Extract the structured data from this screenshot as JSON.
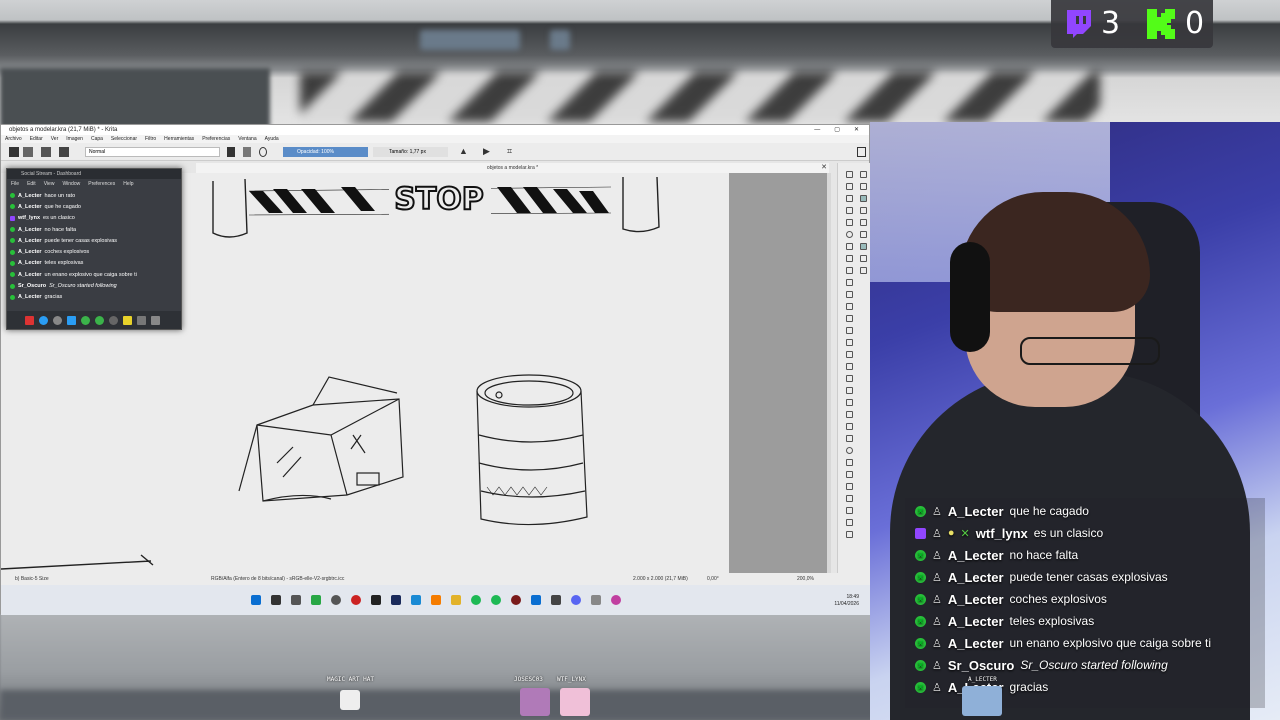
{
  "window": {
    "title": "objetos a modelar.kra (21,7 MiB) * - Krita"
  },
  "menu": [
    "Archivo",
    "Editar",
    "Ver",
    "Imagen",
    "Capa",
    "Seleccionar",
    "Filtro",
    "Herramientas",
    "Preferencias",
    "Ventana",
    "Ayuda"
  ],
  "toolbar": {
    "blend_mode": "Normal",
    "opacity": "Opacidad: 100%",
    "size": "Tamaño: 1,77 px"
  },
  "document_tab": {
    "title": "objetos a modelar.kra *"
  },
  "canvas": {
    "sign_text": "STOP"
  },
  "statusbar": {
    "brush": "b) Basic-5 Size",
    "color_info": "RGB/Alfa (Entero de 8 bits/canal) - sRGB-elle-V2-srgbtrc.icc",
    "dims": "2.000 x 2.000 (21,7 MiB)",
    "angle": "0,00°",
    "zoom": "200,0%"
  },
  "taskbar": {
    "time": "18:49",
    "date": "11/04/2026"
  },
  "social": {
    "title": "Social Stream - Dashboard",
    "menu": [
      "File",
      "Edit",
      "View",
      "Window",
      "Preferences",
      "Help"
    ],
    "messages": [
      {
        "name": "A_Lecter",
        "text": "hace un rato",
        "platform": "kick"
      },
      {
        "name": "A_Lecter",
        "text": "que he cagado",
        "platform": "kick"
      },
      {
        "name": "wtf_lynx",
        "text": "es un clasico",
        "platform": "twitch"
      },
      {
        "name": "A_Lecter",
        "text": "no hace falta",
        "platform": "kick"
      },
      {
        "name": "A_Lecter",
        "text": "puede tener casas explosivas",
        "platform": "kick"
      },
      {
        "name": "A_Lecter",
        "text": "coches explosivos",
        "platform": "kick"
      },
      {
        "name": "A_Lecter",
        "text": "teles explosivas",
        "platform": "kick"
      },
      {
        "name": "A_Lecter",
        "text": "un enano explosivo que caiga sobre ti",
        "platform": "kick"
      },
      {
        "name": "Sr_Oscuro",
        "text": "Sr_Oscuro started following",
        "platform": "kick"
      },
      {
        "name": "A_Lecter",
        "text": "gracias",
        "platform": "kick"
      }
    ]
  },
  "counters": {
    "twitch": "3",
    "kick": "0",
    "twitch_color": "#9146ff",
    "kick_color": "#53fc18"
  },
  "chat": [
    {
      "name": "A_Lecter",
      "text": "que he cagado",
      "platform": "kick"
    },
    {
      "name": "wtf_lynx",
      "text": "es un clasico",
      "platform": "twitch"
    },
    {
      "name": "A_Lecter",
      "text": "no hace falta",
      "platform": "kick"
    },
    {
      "name": "A_Lecter",
      "text": "puede tener casas explosivas",
      "platform": "kick"
    },
    {
      "name": "A_Lecter",
      "text": "coches explosivos",
      "platform": "kick"
    },
    {
      "name": "A_Lecter",
      "text": "teles explosivas",
      "platform": "kick"
    },
    {
      "name": "A_Lecter",
      "text": "un enano explosivo que caiga sobre ti",
      "platform": "kick"
    },
    {
      "name": "Sr_Oscuro",
      "text": "Sr_Oscuro started following",
      "platform": "kick"
    },
    {
      "name": "A_Lecter",
      "text": "gracias",
      "platform": "kick"
    }
  ],
  "characters": [
    "MAGIC ART HAT",
    "JOSESC03",
    "WTF_LYNX",
    "A_LECTER"
  ]
}
